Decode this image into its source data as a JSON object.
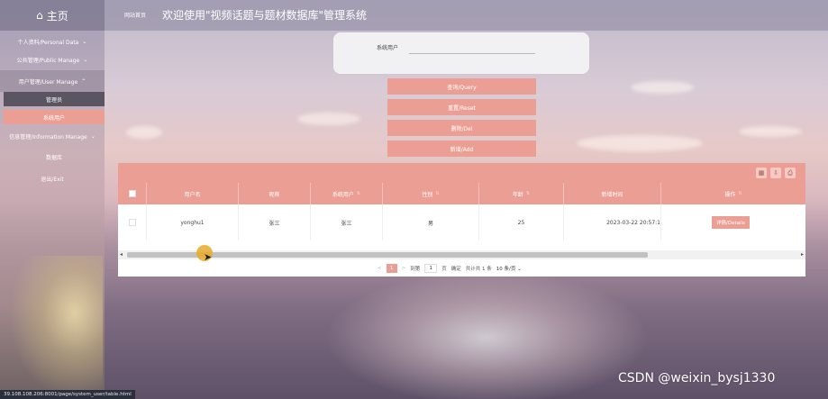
{
  "app": {
    "brand": "主页",
    "site_home": "网站首页",
    "title": "欢迎使用\"视频话题与题材数据库\"管理系统"
  },
  "sidebar": {
    "items": [
      {
        "label": "个人资料/Personal Data"
      },
      {
        "label": "公共管理/Public Manage"
      },
      {
        "label": "用户管理/User Manage",
        "sub": [
          "管理员",
          "系统用户"
        ],
        "active_sub": "系统用户"
      },
      {
        "label": "信息管理/Information Manage",
        "sub": [
          "数据库"
        ]
      },
      {
        "label": "退出/Exit"
      }
    ]
  },
  "search": {
    "label": "系统用户",
    "value": ""
  },
  "actions": {
    "query": "查询/Query",
    "reset": "重置/Reset",
    "delete": "删除/Del",
    "add": "新增/Add"
  },
  "table": {
    "columns": [
      "用户名",
      "昵称",
      "系统用户",
      "性别",
      "年龄",
      "新增时间",
      "操作"
    ],
    "rows": [
      {
        "username": "yonghu1",
        "nickname": "张三",
        "system_user": "张三",
        "gender": "男",
        "age": "25",
        "created": "2023-03-22 20:57:1",
        "action": "详情/Details"
      }
    ]
  },
  "pagination": {
    "prev": "<",
    "current": "1",
    "next": ">",
    "goto_label": "到第",
    "page_input": "1",
    "page_unit": "页",
    "confirm": "确定",
    "total": "共计共 1 条",
    "page_size": "10 条/页"
  },
  "statusbar": {
    "url": "39.108.108.206:8001/page/system_user/table.html"
  },
  "watermark": "CSDN @weixin_bysj1330"
}
